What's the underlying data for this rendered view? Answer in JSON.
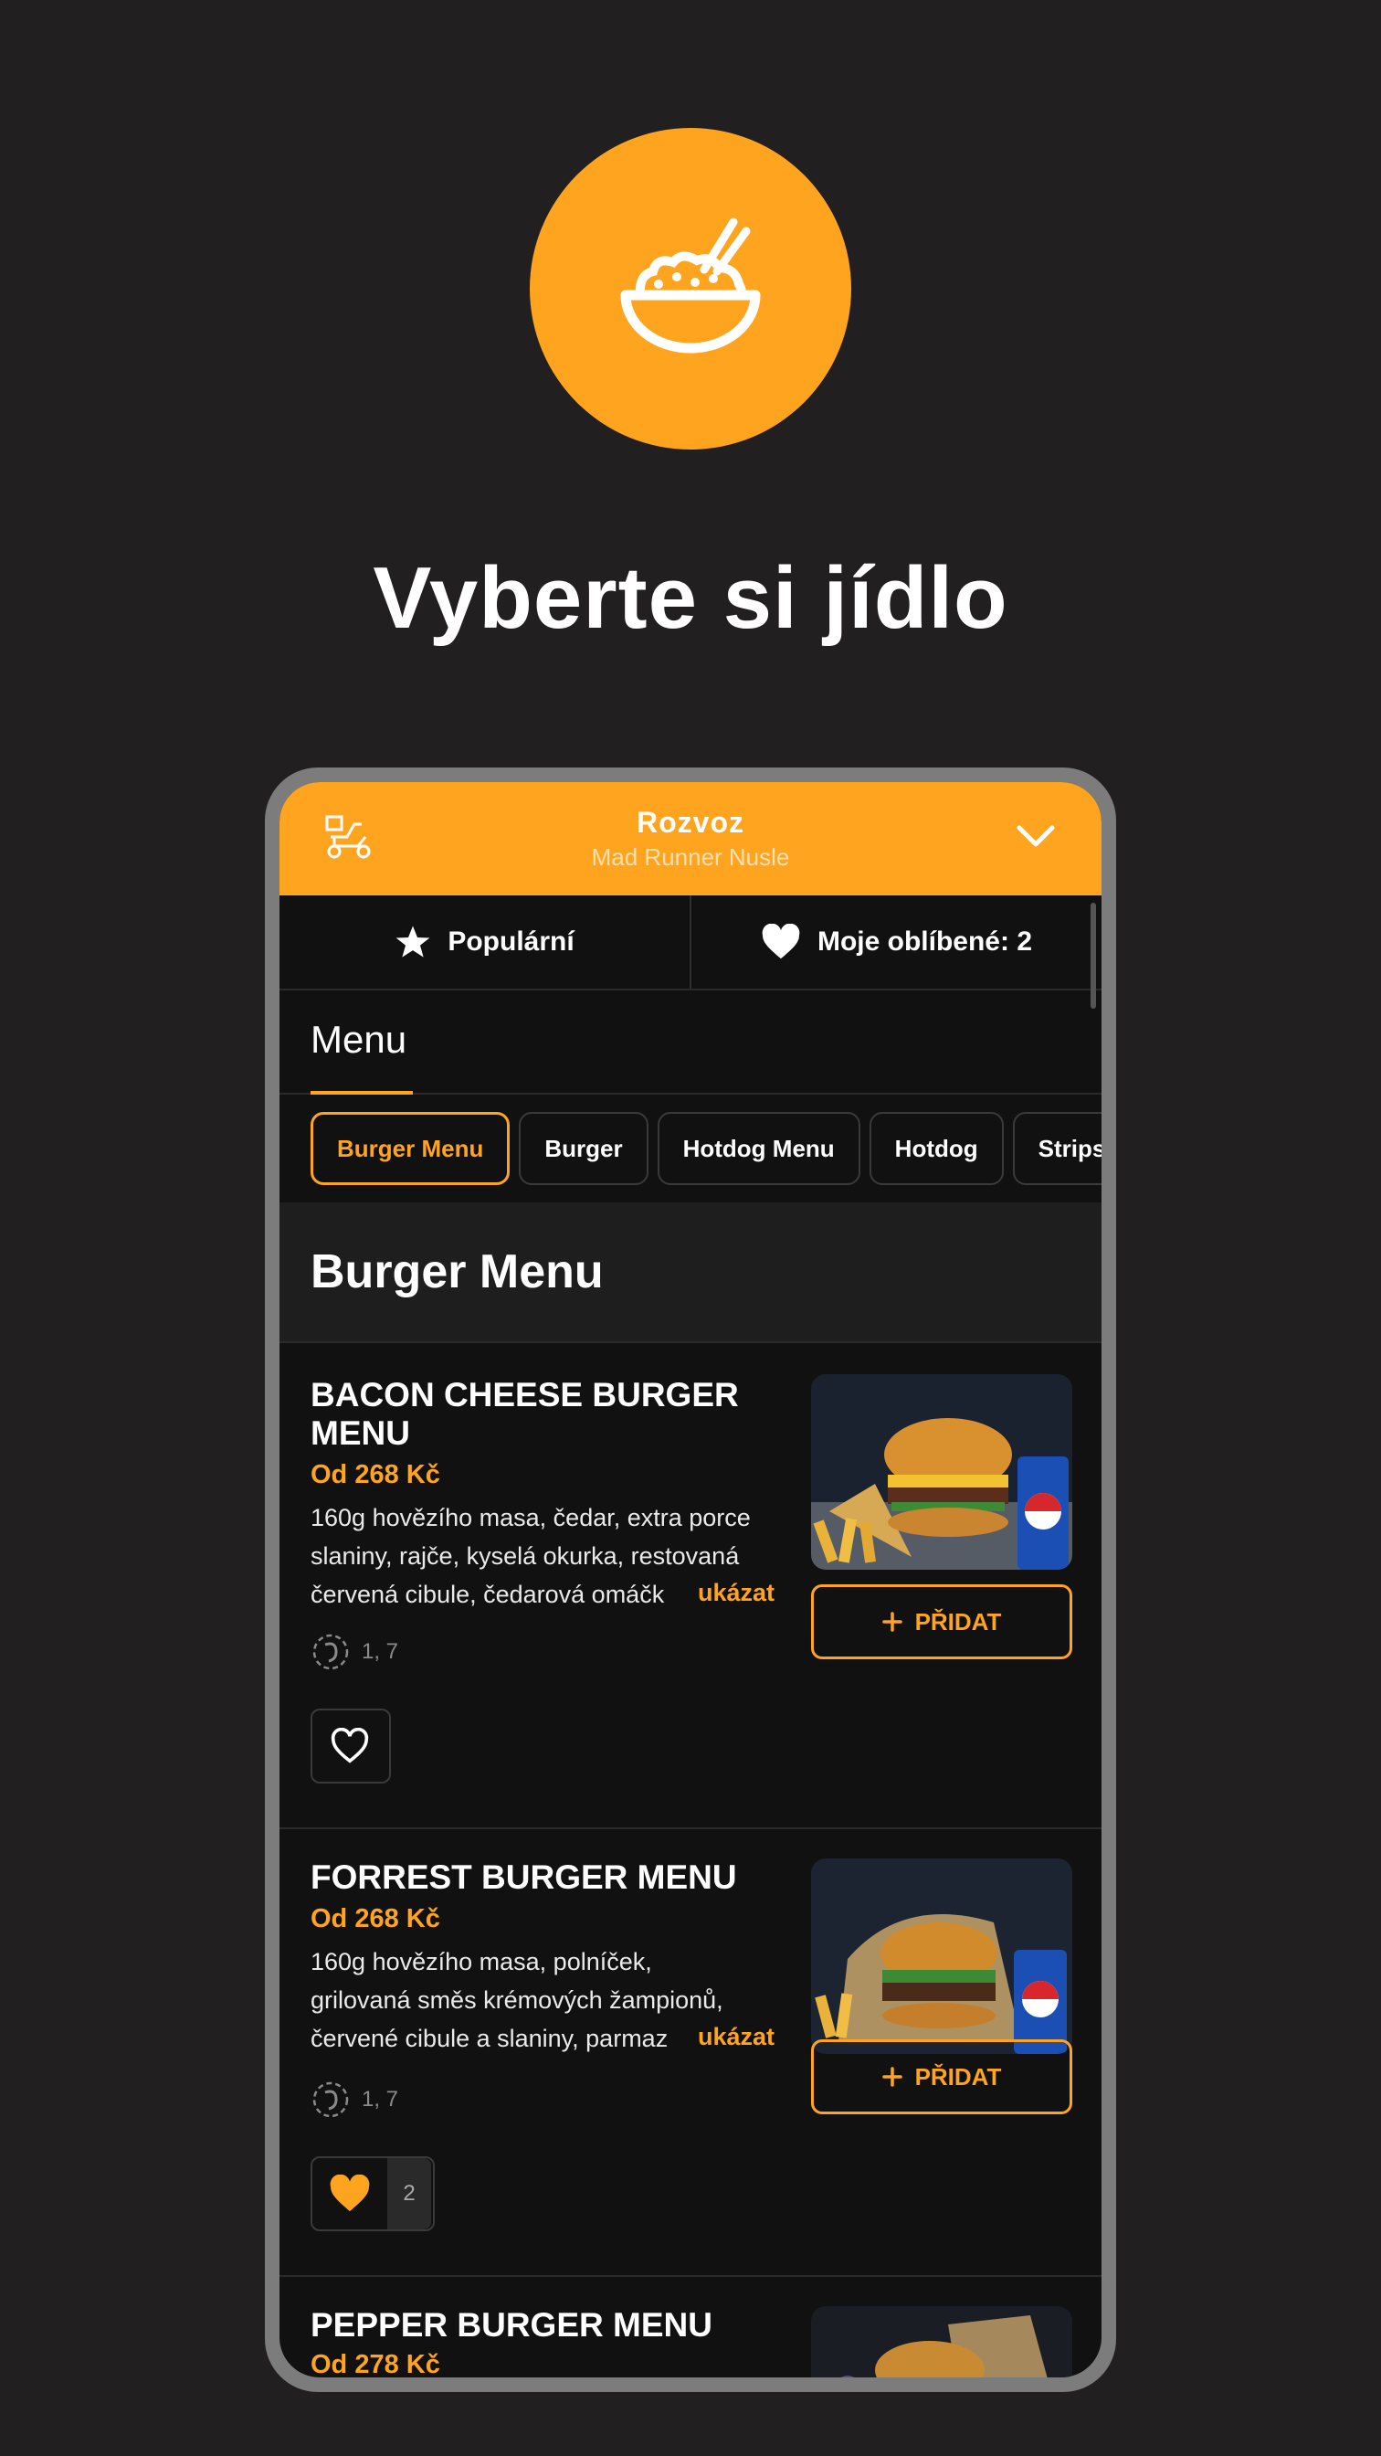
{
  "hero": {
    "icon": "rice-bowl-icon",
    "title": "Vyberte si jídlo",
    "circle_color": "#ffa41f"
  },
  "topbar": {
    "title": "Rozvoz",
    "subtitle": "Mad Runner Nusle",
    "left_icon": "delivery-scooter-icon",
    "right_icon": "chevron-down-icon"
  },
  "tabs": [
    {
      "label": "Populární",
      "icon": "star-icon"
    },
    {
      "label": "Moje oblíbené: 2",
      "icon": "heart-icon"
    }
  ],
  "menu_tab": {
    "label": "Menu"
  },
  "categories": [
    "Burger Menu",
    "Burger",
    "Hotdog Menu",
    "Hotdog",
    "Strips B"
  ],
  "active_category": "Burger Menu",
  "section": {
    "title": "Burger Menu"
  },
  "items": [
    {
      "name_line1": "BACON CHEESE BURGER",
      "name_line2": "MENU",
      "price": "Od 268 Kč",
      "desc_line1": "160g hovězího masa, čedar, extra porce",
      "desc_line2": "slaniny, rajče, kyselá okurka, restovaná",
      "desc_line3": "červená cibule, čedarová omáčk",
      "more": "ukázat",
      "allergens": "1, 7",
      "add": "PŘIDAT",
      "favorited": false
    },
    {
      "name_line1": "FORREST BURGER MENU",
      "price": "Od 268 Kč",
      "desc_line1": "160g hovězího masa, polníček,",
      "desc_line2": "grilovaná směs krémových žampionů,",
      "desc_line3": "červené cibule a slaniny, parmaz",
      "more": "ukázat",
      "allergens": "1, 7",
      "add": "PŘIDAT",
      "favorited": true,
      "fav_count": "2"
    },
    {
      "name_line1": "PEPPER BURGER MENU",
      "price": "Od 278 Kč"
    }
  ],
  "colors": {
    "accent": "#ffa41f",
    "background": "#221f20",
    "screen": "#111111"
  }
}
